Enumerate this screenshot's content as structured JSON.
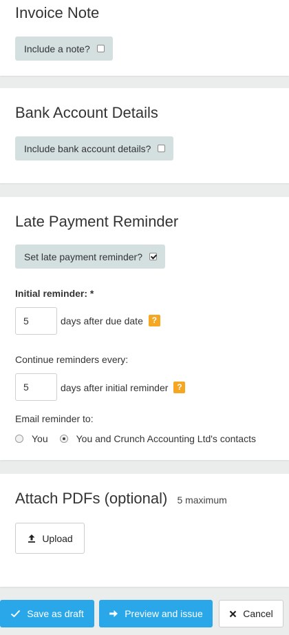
{
  "invoice_note": {
    "title": "Invoice Note",
    "toggle_label": "Include a note?",
    "checked": false
  },
  "bank_details": {
    "title": "Bank Account Details",
    "toggle_label": "Include bank account details?",
    "checked": false
  },
  "late_payment": {
    "title": "Late Payment Reminder",
    "toggle_label": "Set late payment reminder?",
    "checked": true,
    "initial_label": "Initial reminder: *",
    "initial_value": "5",
    "initial_suffix": "days after due date",
    "continue_label": "Continue reminders every:",
    "continue_value": "5",
    "continue_suffix": "days after initial reminder",
    "email_label": "Email reminder to:",
    "email_options": [
      {
        "label": "You",
        "selected": false
      },
      {
        "label": "You and Crunch Accounting Ltd's contacts",
        "selected": true
      }
    ],
    "help_glyph": "?"
  },
  "attach": {
    "title": "Attach PDFs (optional)",
    "max_note": "5 maximum",
    "upload_label": "Upload"
  },
  "footer": {
    "save_label": "Save as draft",
    "preview_label": "Preview and issue",
    "cancel_label": "Cancel"
  },
  "colors": {
    "accent": "#2aa7e8",
    "pill": "#d4e0e0",
    "help": "#f5a623",
    "background": "#ebeded"
  },
  "icons": {
    "save": "check-icon",
    "preview": "arrow-right-icon",
    "cancel": "close-icon",
    "upload": "upload-icon",
    "help": "help-icon"
  }
}
